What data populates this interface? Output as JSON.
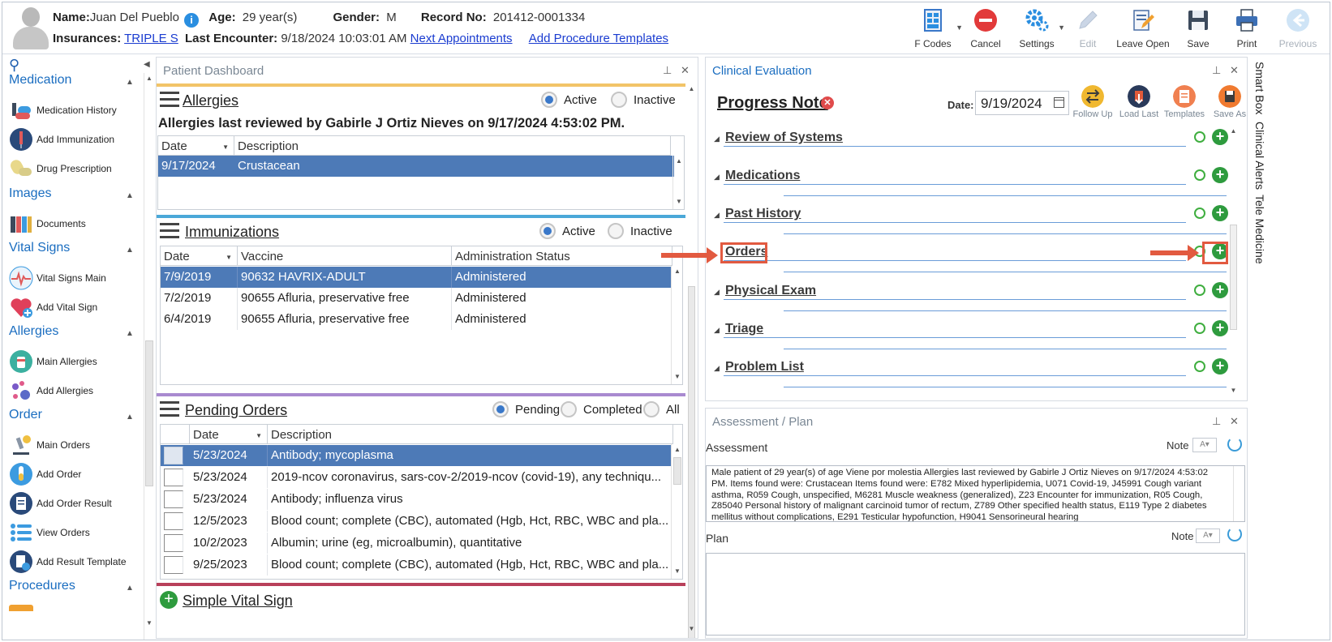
{
  "header": {
    "name_label": "Name:",
    "name_value": "Juan Del Pueblo",
    "age_label": "Age:",
    "age_value": "29 year(s)",
    "gender_label": "Gender:",
    "gender_value": "M",
    "record_label": "Record No:",
    "record_value": "201412-0001334",
    "insurances_label": "Insurances:",
    "insurances_value": "TRIPLE S",
    "last_encounter_label": "Last Encounter:",
    "last_encounter_value": "9/18/2024 10:03:01 AM",
    "next_appointments": "Next Appointments",
    "add_procedure_templates": "Add Procedure Templates"
  },
  "toolbar": {
    "f_codes": "F Codes",
    "cancel": "Cancel",
    "settings": "Settings",
    "edit": "Edit",
    "leave_open": "Leave Open",
    "save": "Save",
    "print": "Print",
    "previous": "Previous"
  },
  "sidebar": {
    "sections": [
      {
        "title": "Medication",
        "items": [
          "Medication History",
          "Add Immunization",
          "Drug Prescription"
        ]
      },
      {
        "title": "Images",
        "items": [
          "Documents"
        ]
      },
      {
        "title": "Vital Signs",
        "items": [
          "Vital Signs Main",
          "Add Vital Sign"
        ]
      },
      {
        "title": "Allergies",
        "items": [
          "Main Allergies",
          "Add Allergies"
        ]
      },
      {
        "title": "Order",
        "items": [
          "Main Orders",
          "Add Order",
          "Add Order Result",
          "View Orders",
          "Add Result Template"
        ]
      },
      {
        "title": "Procedures",
        "items": []
      }
    ]
  },
  "dashboard": {
    "title": "Patient Dashboard",
    "allergies": {
      "title": "Allergies",
      "active": "Active",
      "inactive": "Inactive",
      "reviewed": "Allergies last reviewed by Gabirle J Ortiz Nieves on 9/17/2024 4:53:02 PM.",
      "columns": [
        "Date",
        "Description"
      ],
      "rows": [
        [
          "9/17/2024",
          "Crustacean"
        ]
      ]
    },
    "immunizations": {
      "title": "Immunizations",
      "active": "Active",
      "inactive": "Inactive",
      "columns": [
        "Date",
        "Vaccine",
        "Administration Status"
      ],
      "rows": [
        [
          "7/9/2019",
          "90632 HAVRIX-ADULT",
          "Administered"
        ],
        [
          "7/2/2019",
          "90655 Afluria, preservative free",
          "Administered"
        ],
        [
          "6/4/2019",
          "90655 Afluria, preservative free",
          "Administered"
        ]
      ]
    },
    "pending_orders": {
      "title": "Pending Orders",
      "pending": "Pending",
      "completed": "Completed",
      "all": "All",
      "columns": [
        "Date",
        "Description"
      ],
      "rows": [
        [
          "5/23/2024",
          "Antibody; mycoplasma"
        ],
        [
          "5/23/2024",
          "2019-ncov coronavirus, sars-cov-2/2019-ncov (covid-19), any techniqu..."
        ],
        [
          "5/23/2024",
          "Antibody; influenza virus"
        ],
        [
          "12/5/2023",
          "Blood count; complete (CBC), automated (Hgb, Hct, RBC, WBC and pla..."
        ],
        [
          "10/2/2023",
          "Albumin; urine (eg, microalbumin), quantitative"
        ],
        [
          "9/25/2023",
          "Blood count; complete (CBC), automated (Hgb, Hct, RBC, WBC and pla..."
        ]
      ]
    },
    "simple_vital_sign": "Simple Vital Sign"
  },
  "clinical": {
    "title": "Clinical Evaluation",
    "progress_note": "Progress Note",
    "date_label": "Date:",
    "date_value": "9/19/2024",
    "buttons": {
      "follow_up": "Follow Up",
      "load_last": "Load Last",
      "templates": "Templates",
      "save_as": "Save As"
    },
    "sections": [
      "Review of Systems",
      "Medications",
      "Past History",
      "Orders",
      "Physical Exam",
      "Triage",
      "Problem List"
    ]
  },
  "assessment_plan": {
    "title": "Assessment / Plan",
    "assessment_label": "Assessment",
    "plan_label": "Plan",
    "note_label": "Note",
    "assessment_text": "Male patient of 29 year(s) of age Viene por molestia     Allergies last reviewed by Gabirle J Ortiz Nieves on 9/17/2024 4:53:02 PM.    Items found were:  Crustacean  Items found were:  E782 Mixed hyperlipidemia, U071 Covid-19, J45991 Cough variant asthma, R059 Cough, unspecified, M6281 Muscle weakness (generalized), Z23 Encounter for immunization, R05 Cough, Z85040 Personal history of malignant carcinoid tumor of rectum, Z789 Other specified health status, E119 Type 2 diabetes mellitus without complications, E291 Testicular hypofunction, H9041 Sensorineural hearing"
  },
  "right_tabs": [
    "Smart Box",
    "Clinical Alerts",
    "Tele Medicine"
  ]
}
